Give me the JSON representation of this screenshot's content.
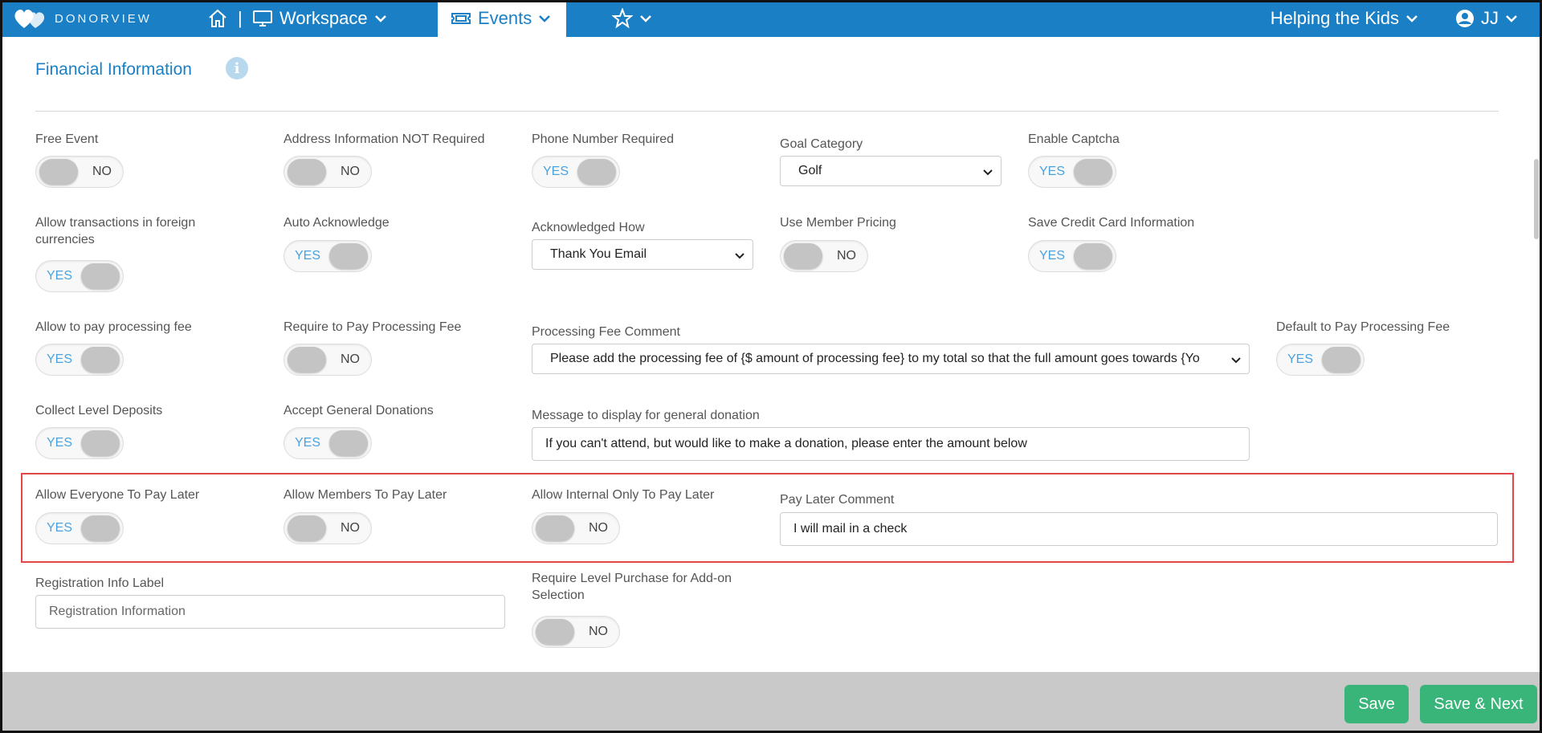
{
  "nav": {
    "logo_text": "DONORVIEW",
    "separator": "|",
    "workspace": "Workspace",
    "events": "Events",
    "org": "Helping the Kids",
    "user": "JJ"
  },
  "section": {
    "title": "Financial Information"
  },
  "fields": {
    "free_event": {
      "label": "Free Event",
      "state": "NO"
    },
    "address_not_required": {
      "label": "Address Information NOT Required",
      "state": "NO"
    },
    "phone_required": {
      "label": "Phone Number Required",
      "state": "YES"
    },
    "goal_category": {
      "label": "Goal Category",
      "value": "Golf"
    },
    "enable_captcha": {
      "label": "Enable Captcha",
      "state": "YES"
    },
    "foreign_currencies": {
      "label_line1": "Allow transactions in foreign",
      "label_line2": "currencies",
      "state": "YES"
    },
    "auto_acknowledge": {
      "label": "Auto Acknowledge",
      "state": "YES"
    },
    "acknowledged_how": {
      "label": "Acknowledged How",
      "value": "Thank You Email"
    },
    "member_pricing": {
      "label": "Use Member Pricing",
      "state": "NO"
    },
    "save_credit_card": {
      "label": "Save Credit Card Information",
      "state": "YES"
    },
    "allow_processing_fee": {
      "label": "Allow to pay processing fee",
      "state": "YES"
    },
    "require_processing_fee": {
      "label": "Require to Pay Processing Fee",
      "state": "NO"
    },
    "processing_fee_comment": {
      "label": "Processing Fee Comment",
      "value": "Please add the processing fee of {$ amount of processing fee} to my total so that the full amount goes towards {Yo"
    },
    "default_processing_fee": {
      "label": "Default to Pay Processing Fee",
      "state": "YES"
    },
    "collect_level_deposits": {
      "label": "Collect Level Deposits",
      "state": "YES"
    },
    "accept_general_donations": {
      "label": "Accept General Donations",
      "state": "YES"
    },
    "general_donation_message": {
      "label": "Message to display for general donation",
      "value": "If you can't attend, but would like to make a donation, please enter the amount below"
    },
    "everyone_pay_later": {
      "label": "Allow Everyone To Pay Later",
      "state": "YES"
    },
    "members_pay_later": {
      "label": "Allow Members To Pay Later",
      "state": "NO"
    },
    "internal_pay_later": {
      "label": "Allow Internal Only To Pay Later",
      "state": "NO"
    },
    "pay_later_comment": {
      "label": "Pay Later Comment",
      "value": "I will mail in a check"
    },
    "registration_info_label": {
      "label": "Registration Info Label",
      "placeholder": "Registration Information"
    },
    "require_level_purchase": {
      "label_line1": "Require Level Purchase for Add-on",
      "label_line2": "Selection",
      "state": "NO"
    }
  },
  "footer": {
    "save": "Save",
    "save_next": "Save & Next"
  },
  "colors": {
    "brand": "#1a7fc4",
    "button": "#3ab57a",
    "highlight": "#e04848"
  }
}
